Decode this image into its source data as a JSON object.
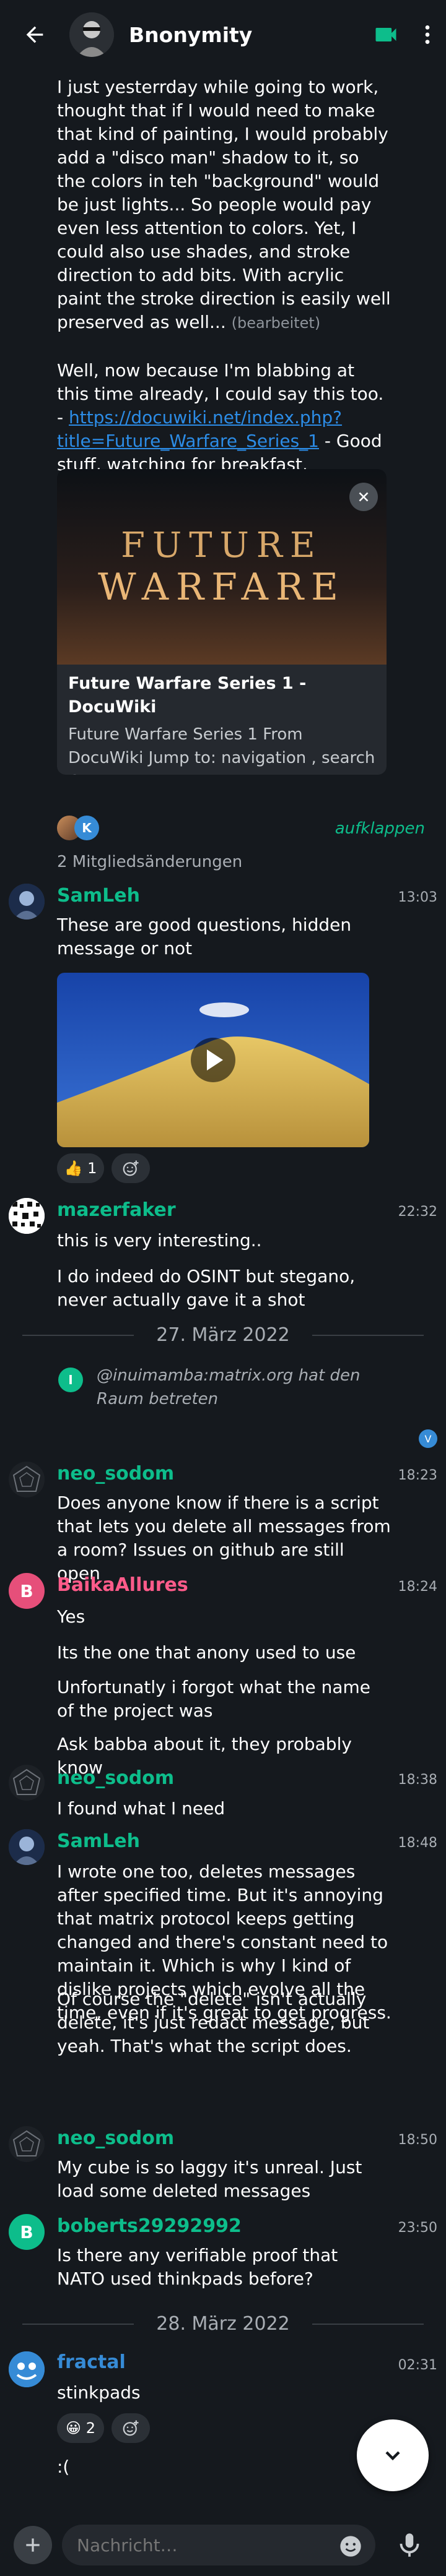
{
  "room": {
    "title": "Bnonymity"
  },
  "messages": {
    "m1_text": "I just yesterrday while going to work, thought that if I would need to make that kind of painting, I would probably add a \"disco man\" shadow to it, so the colors in teh \"background\" would be just lights... So people would pay even less attention to colors. Yet, I could also use shades, and stroke direction to add bits.  With acrylic paint the stroke direction is easily well preserved as well...",
    "m1_edited": "(bearbeitet)",
    "m2_text_before": "Well, now because I'm blabbing at this time already, I could say this too. - ",
    "m2_link": "https://docuwiki.net/index.php?title=Future_Warfare_Series_1",
    "m2_text_after": " - Good stuff, watching for breakfast.",
    "preview": {
      "banner_line1": "FUTURE",
      "banner_line2": "WARFARE",
      "title": "Future Warfare Series 1 - DocuWiki",
      "desc": "Future Warfare Series 1 From DocuWiki Jump to: navigation , search Contents …"
    },
    "member_changes": "2 Mitgliedsänderungen",
    "expand": "aufklappen",
    "member_avatar_k": "K",
    "samleh_1": {
      "name": "SamLeh",
      "time": "13:03",
      "text": "These are good questions, hidden message or not"
    },
    "reaction_thumbs": {
      "emoji": "👍",
      "count": "1"
    },
    "mazerfaker": {
      "name": "mazerfaker",
      "time": "22:32",
      "text1": "this is very interesting..",
      "text2": "I do indeed do OSINT but stegano, never actually gave it a shot"
    },
    "day1": "27. März 2022",
    "join_event": {
      "initial": "I",
      "text": "@inuimamba:matrix.org hat den Raum betreten"
    },
    "read_marker": "V",
    "neo_1": {
      "name": "neo_sodom",
      "time": "18:23",
      "text": "Does anyone know if there is a script that lets you delete all messages from a room? Issues on github are still open"
    },
    "baika": {
      "initial": "B",
      "name": "BaikaAllures",
      "time": "18:24",
      "text1": "Yes",
      "text2": "Its the one that anony used to use",
      "text3": "Unfortunatly i forgot what the name of the project was",
      "text4": "Ask babba about it, they probably know"
    },
    "neo_2": {
      "name": "neo_sodom",
      "time": "18:38",
      "text": "I found what I need"
    },
    "samleh_2": {
      "name": "SamLeh",
      "time": "18:48",
      "text1": "I wrote one too, deletes messages after specified time. But it's annoying that matrix protocol keeps getting changed and there's constant need to maintain it. Which is why I kind of dislike projects which evolve all the time, even if it's great to get progress.",
      "text2": "Of course the \"delete\" isn't actually delete, it's just redact message, but yeah. That's what the script does."
    },
    "neo_3": {
      "name": "neo_sodom",
      "time": "18:50",
      "text": "My cube is so laggy it's unreal. Just load some deleted messages"
    },
    "boberts": {
      "initial": "B",
      "name": "boberts29292992",
      "time": "23:50",
      "text": "Is there any verifiable proof that NATO used thinkpads before?"
    },
    "day2": "28. März 2022",
    "fractal": {
      "name": "fractal",
      "time": "02:31",
      "text1": "stinkpads",
      "text2": ":("
    },
    "reaction_grin": {
      "emoji": "😀",
      "count": "2"
    }
  },
  "composer": {
    "placeholder": "Nachricht…"
  },
  "colors": {
    "background": "#15191e",
    "accent_green": "#0dbd8b",
    "link_blue": "#2c8ce6",
    "name_green": "#0dbd8b",
    "name_pink": "#ff5b55",
    "name_blue": "#368bd6"
  }
}
